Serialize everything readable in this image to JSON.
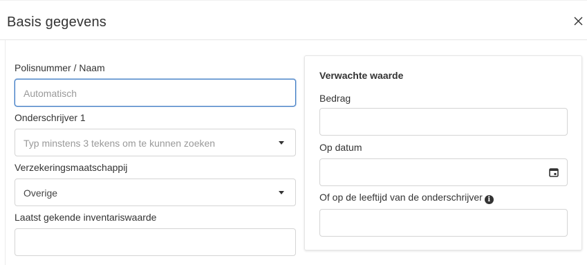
{
  "modal": {
    "title": "Basis gegevens",
    "close_label": "×"
  },
  "left": {
    "policy": {
      "label": "Polisnummer / Naam",
      "placeholder": "Automatisch",
      "value": ""
    },
    "insured": {
      "label": "Onderschrijver 1",
      "placeholder": "Typ minstens 3 tekens om te kunnen zoeken"
    },
    "insurer": {
      "label": "Verzekeringsmaatschappij",
      "selected": "Overige"
    },
    "inventory": {
      "label": "Laatst gekende inventariswaarde",
      "value": ""
    }
  },
  "right": {
    "title": "Verwachte waarde",
    "amount": {
      "label": "Bedrag",
      "value": ""
    },
    "date": {
      "label": "Op datum",
      "value": "",
      "icon": "calendar-icon"
    },
    "age": {
      "label": "Of op de leeftijd van de onderschrijver",
      "value": "",
      "icon": "info-icon",
      "info_glyph": "i"
    }
  },
  "colors": {
    "focus_border": "#3a78c3",
    "field_border": "#d4d4d4",
    "placeholder": "#999999"
  }
}
